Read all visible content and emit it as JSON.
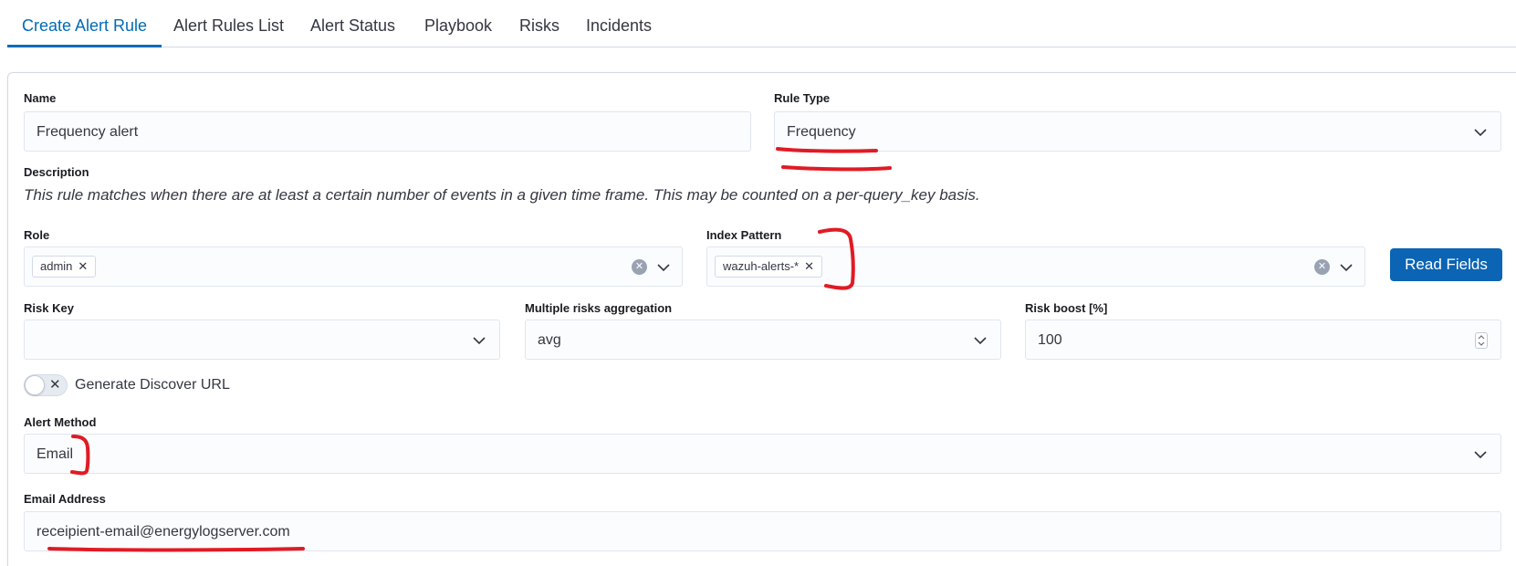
{
  "tabs": [
    {
      "label": "Create Alert Rule",
      "active": true
    },
    {
      "label": "Alert Rules List"
    },
    {
      "label": "Alert Status"
    },
    {
      "label": "Playbook"
    },
    {
      "label": "Risks"
    },
    {
      "label": "Incidents"
    }
  ],
  "form": {
    "name": {
      "label": "Name",
      "value": "Frequency alert"
    },
    "rule_type": {
      "label": "Rule Type",
      "value": "Frequency"
    },
    "description": {
      "label": "Description",
      "text": "This rule matches when there are at least a certain number of events in a given time frame. This may be counted on a per-query_key basis."
    },
    "role": {
      "label": "Role",
      "tags": [
        "admin"
      ]
    },
    "index_pattern": {
      "label": "Index Pattern",
      "tags": [
        "wazuh-alerts-*"
      ]
    },
    "read_fields_button": "Read Fields",
    "risk_key": {
      "label": "Risk Key",
      "value": ""
    },
    "multiple_risks": {
      "label": "Multiple risks aggregation",
      "value": "avg"
    },
    "risk_boost": {
      "label": "Risk boost [%]",
      "value": "100"
    },
    "discover_toggle": {
      "label": "Generate Discover URL",
      "on": false,
      "icon": "x-icon"
    },
    "alert_method": {
      "label": "Alert Method",
      "value": "Email"
    },
    "email_address": {
      "label": "Email Address",
      "value": "receipient-email@energylogserver.com"
    }
  },
  "colors": {
    "accent": "#006bb8",
    "button": "#0b64b4",
    "annotation": "#e01b24"
  }
}
